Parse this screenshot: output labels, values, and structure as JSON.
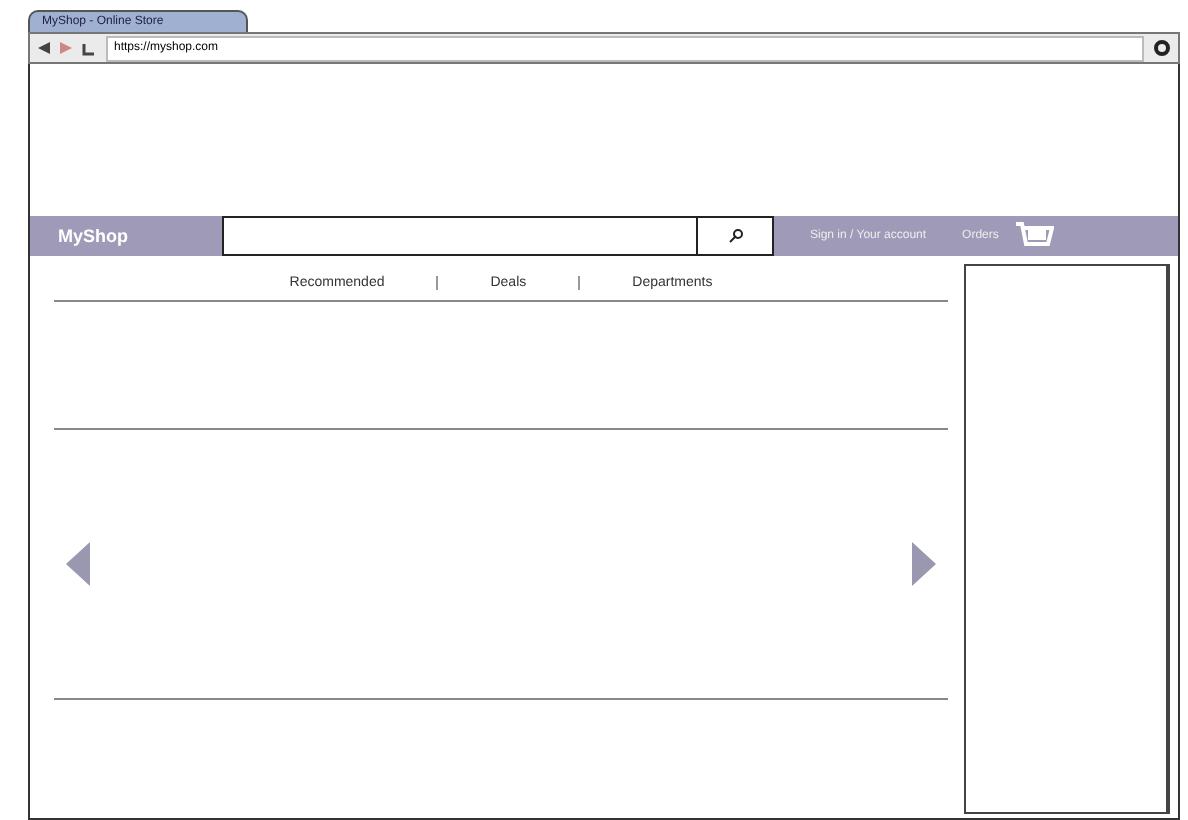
{
  "browser": {
    "tab_title": "MyShop - Online Store",
    "url": "https://myshop.com"
  },
  "header": {
    "logo": "MyShop",
    "account_link": "Sign in / Your account",
    "orders_link": "Orders"
  },
  "nav": [
    {
      "label": "Recommended"
    },
    {
      "label": "Deals"
    },
    {
      "label": "Departments"
    }
  ]
}
